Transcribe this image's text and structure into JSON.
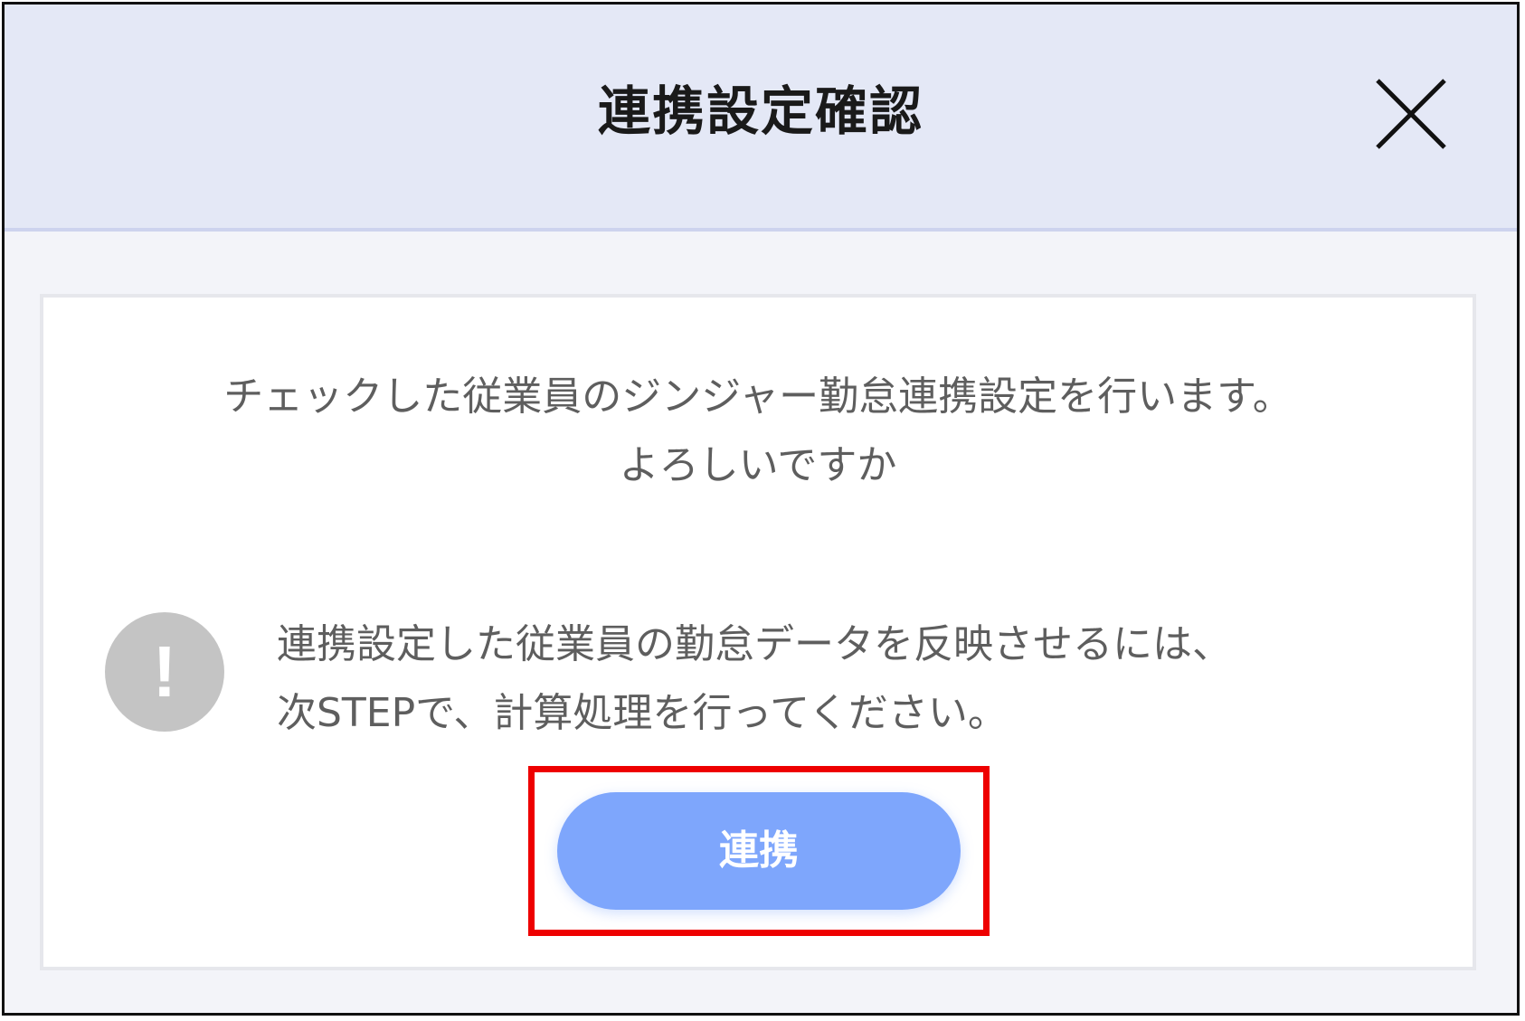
{
  "modal": {
    "title": "連携設定確認",
    "close_icon": "close-icon",
    "confirm_message": {
      "line1": "チェックした従業員のジンジャー勤怠連携設定を行います。",
      "line2": "よろしいですか"
    },
    "notice": {
      "icon": "exclamation-icon",
      "icon_glyph": "!",
      "line1": "連携設定した従業員の勤怠データを反映させるには、",
      "line2": "次STEPで、計算処理を行ってください。"
    },
    "link_button_label": "連携"
  },
  "colors": {
    "header_bg": "#e4e8f6",
    "body_bg": "#f3f4f9",
    "button_bg": "#7ea6fc",
    "highlight": "#ee0000",
    "notice_icon": "#c4c4c4"
  }
}
